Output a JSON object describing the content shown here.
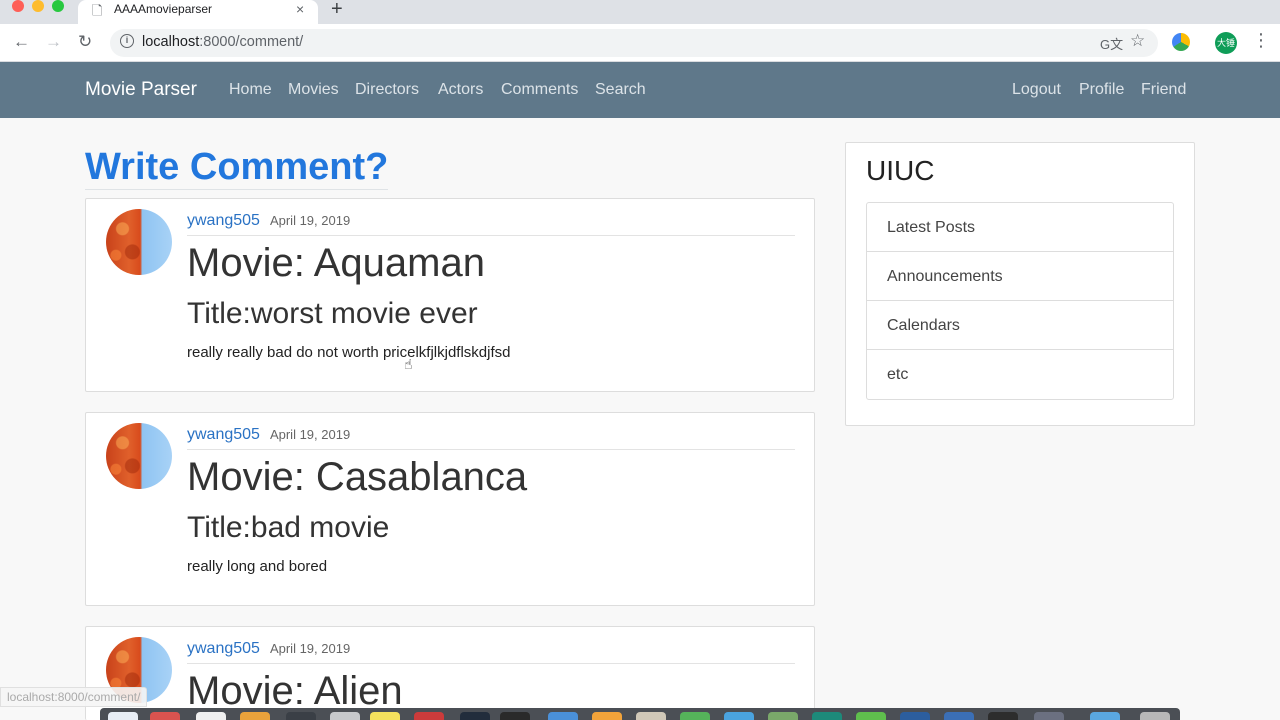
{
  "browser": {
    "tab_title": "AAAAmovieparser",
    "tab_close": "×",
    "new_tab": "+",
    "url_host": "localhost",
    "url_path": ":8000/comment/",
    "back": "←",
    "forward": "→",
    "reload": "↻",
    "info": "i",
    "translate_glyph": "G文",
    "star": "☆",
    "profile_initials": "大锤",
    "menu": "⋮",
    "status_url": "localhost:8000/comment/"
  },
  "navbar": {
    "brand": "Movie Parser",
    "left_links": [
      "Home",
      "Movies",
      "Directors",
      "Actors",
      "Comments",
      "Search"
    ],
    "right_links": [
      "Logout",
      "Profile",
      "Friend"
    ]
  },
  "main": {
    "heading": "Write Comment?",
    "comments": [
      {
        "author": "ywang505",
        "date": "April 19, 2019",
        "movie": "Movie: Aquaman",
        "title": "Title:worst movie ever",
        "body": "really really bad do not worth pricelkfjlkjdflskdjfsd"
      },
      {
        "author": "ywang505",
        "date": "April 19, 2019",
        "movie": "Movie: Casablanca",
        "title": "Title:bad movie",
        "body": "really long and bored"
      },
      {
        "author": "ywang505",
        "date": "April 19, 2019",
        "movie": "Movie: Alien",
        "title": "",
        "body": ""
      }
    ]
  },
  "sidebar": {
    "title": "UIUC",
    "items": [
      "Latest Posts",
      "Announcements",
      "Calendars",
      "etc"
    ]
  },
  "icons": {
    "tab_favicon": "page-icon",
    "cursor": "hand-pointer-icon"
  }
}
